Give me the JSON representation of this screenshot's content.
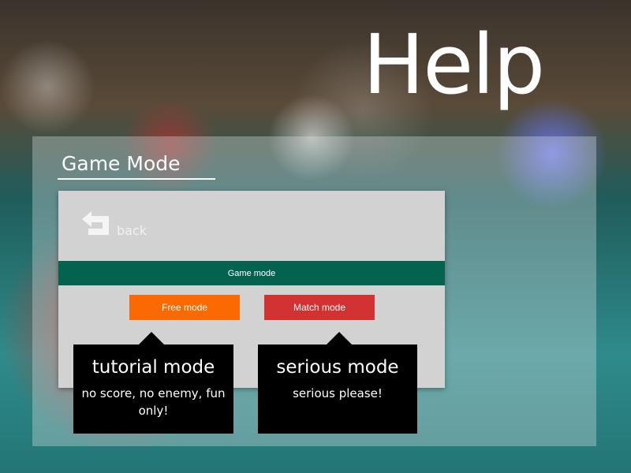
{
  "page": {
    "title": "Help"
  },
  "section": {
    "title": "Game Mode"
  },
  "screen": {
    "back_label": "back",
    "mode_bar_label": "Game mode",
    "buttons": {
      "free": "Free mode",
      "match": "Match mode"
    }
  },
  "tooltips": {
    "free": {
      "title": "tutorial mode",
      "description": "no score, no enemy, fun only!"
    },
    "match": {
      "title": "serious mode",
      "description": "serious please!"
    }
  },
  "colors": {
    "mode_bar": "#03634f",
    "free_button": "#fb6a00",
    "match_button": "#d23232",
    "tooltip_bg": "#000000"
  },
  "icons": {
    "back": "back-arrow-icon"
  }
}
